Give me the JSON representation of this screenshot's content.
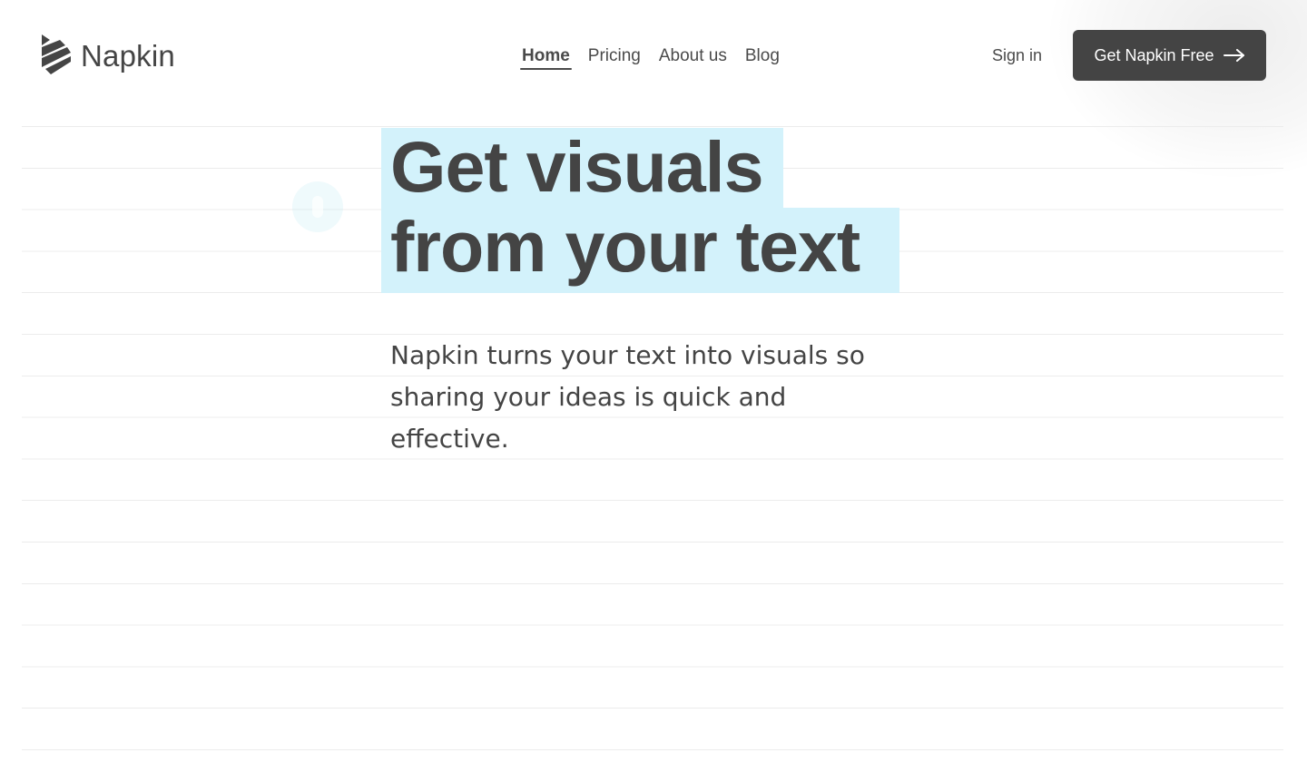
{
  "brand": {
    "name": "Napkin",
    "logo_icon": "napkin-stripes-logo"
  },
  "nav": {
    "items": [
      {
        "label": "Home",
        "active": true
      },
      {
        "label": "Pricing",
        "active": false
      },
      {
        "label": "About us",
        "active": false
      },
      {
        "label": "Blog",
        "active": false
      }
    ]
  },
  "header": {
    "sign_in_label": "Sign in",
    "cta_label": "Get Napkin Free",
    "cta_icon": "arrow-right-icon"
  },
  "hero": {
    "title_line1": "Get visuals",
    "title_line2": "from your text",
    "subtitle": "Napkin turns your text into visuals so sharing your ideas is quick and effective."
  },
  "colors": {
    "text": "#444444",
    "highlight": "#d3f2fb",
    "button_bg": "#444444",
    "button_text": "#ffffff",
    "rule_line": "#ececec"
  }
}
